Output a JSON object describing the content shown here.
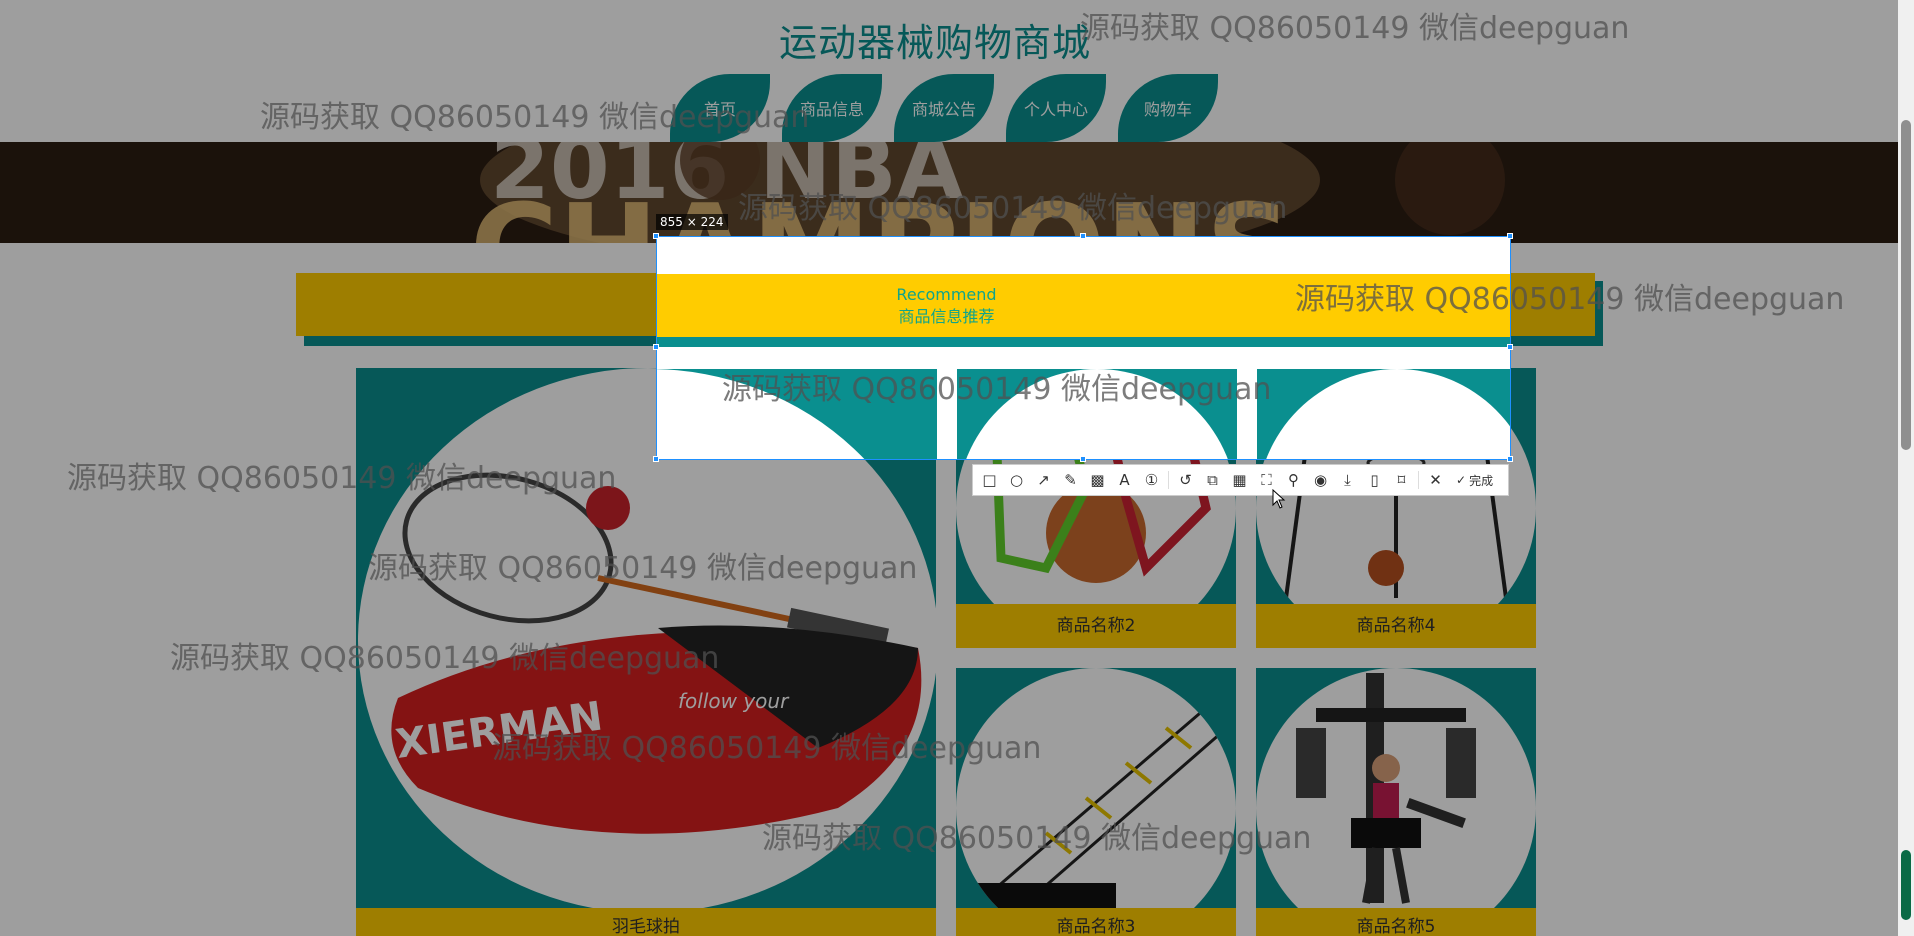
{
  "site": {
    "title": "运动器械购物商城"
  },
  "nav": [
    {
      "label": "首页"
    },
    {
      "label": "商品信息"
    },
    {
      "label": "商城公告"
    },
    {
      "label": "个人中心"
    },
    {
      "label": "购物车"
    }
  ],
  "recommend": {
    "en": "Recommend",
    "cn": "商品信息推荐"
  },
  "products": [
    {
      "name": "羽毛球拍"
    },
    {
      "name": "商品名称2"
    },
    {
      "name": "商品名称4"
    },
    {
      "name": "商品名称3"
    },
    {
      "name": "商品名称5"
    }
  ],
  "capture": {
    "size": "855 × 224",
    "done_label": "完成"
  },
  "watermark": {
    "text": "源码获取 QQ86050149 微信deepguan"
  },
  "colors": {
    "teal": "#0a8f8f",
    "yellow": "#ffcc00",
    "selection": "#1e90ff"
  },
  "toolbar_icons": [
    "rectangle-icon",
    "ellipse-icon",
    "arrow-icon",
    "pencil-icon",
    "mosaic-icon",
    "text-icon",
    "serial-number-icon",
    "undo-icon",
    "long-screenshot-icon",
    "ocr-icon",
    "translate-icon",
    "pin-icon",
    "record-icon",
    "download-icon",
    "save-icon",
    "bookmark-icon",
    "close-icon",
    "done-icon"
  ]
}
